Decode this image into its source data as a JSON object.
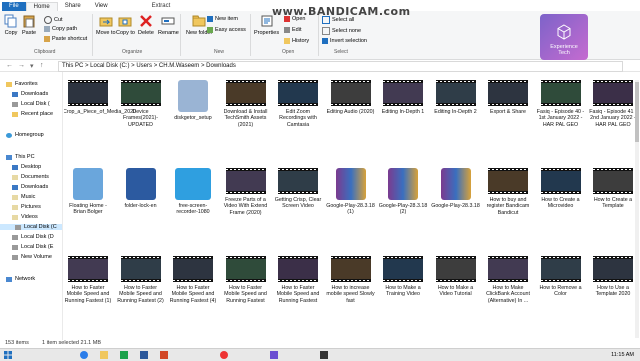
{
  "recorder": {
    "watermark": "www.BANDICAM.com"
  },
  "logo": {
    "line1": "Experience",
    "line2": "Tech"
  },
  "tabs": [
    "File",
    "Home",
    "Share",
    "View",
    "Extract"
  ],
  "ribbon": {
    "copy": "Copy",
    "paste": "Paste",
    "cut": "Cut",
    "copy_path": "Copy path",
    "paste_shortcut": "Paste shortcut",
    "move_to": "Move to",
    "copy_to": "Copy to",
    "delete": "Delete",
    "rename": "Rename",
    "new_folder": "New folder",
    "new_item": "New item",
    "easy_access": "Easy access",
    "properties": "Properties",
    "open": "Open",
    "edit": "Edit",
    "history": "History",
    "select_all": "Select all",
    "select_none": "Select none",
    "invert_selection": "Invert selection",
    "grp_clipboard": "Clipboard",
    "grp_organize": "Organize",
    "grp_new": "New",
    "grp_open": "Open",
    "grp_select": "Select"
  },
  "address": {
    "path": "This PC  >  Local Disk (C:)  >  Users  >  CH.M.Waseem  >  Downloads"
  },
  "nav": {
    "quick_access": "Favorites",
    "items": [
      "Downloads",
      "Local Disk (",
      "Recent place"
    ],
    "homegroup": "Homegroup",
    "this_pc": "This PC",
    "pc_items": [
      "Desktop",
      "Documents",
      "Downloads",
      "Music",
      "Pictures",
      "Videos",
      "Local Disk (C",
      "Local Disk (D",
      "Local Disk (E",
      "New Volume"
    ],
    "network": "Network"
  },
  "files": [
    {
      "name": "Crop_a_Piece_of_Media_2020",
      "kind": "video"
    },
    {
      "name": "Device Frames(2021)-UPDATED",
      "kind": "video"
    },
    {
      "name": "diskgetor_setup",
      "kind": "setup"
    },
    {
      "name": "Download & Install TechSmith Assets (2021)",
      "kind": "video"
    },
    {
      "name": "Edit Zoom Recordings with Camtasia",
      "kind": "video"
    },
    {
      "name": "Editing Audio (2020)",
      "kind": "video"
    },
    {
      "name": "Editing In-Depth 1",
      "kind": "video"
    },
    {
      "name": "Editing In-Depth 2",
      "kind": "video"
    },
    {
      "name": "Export & Share",
      "kind": "video"
    },
    {
      "name": "Fasiq - Episode 40 - 1st January 2022 - HAR PAL GEO",
      "kind": "video"
    },
    {
      "name": "Fasiq - Episode 41 - 2nd January 2022 - HAR PAL GEO",
      "kind": "video"
    },
    {
      "name": "Floating Home - Brian Bolger",
      "kind": "mp3"
    },
    {
      "name": "folder-lock-en",
      "kind": "lock"
    },
    {
      "name": "free-screen-recorder-1080",
      "kind": "recorder"
    },
    {
      "name": "Freeze Parts of a Video With Extend Frame (2020)",
      "kind": "video"
    },
    {
      "name": "Getting Crisp, Clear Screen Video",
      "kind": "video"
    },
    {
      "name": "Google-Play-28.3.18 (1)",
      "kind": "rar"
    },
    {
      "name": "Google-Play-28.3.18 (2)",
      "kind": "rar"
    },
    {
      "name": "Google-Play-28.3.18",
      "kind": "rar"
    },
    {
      "name": "How to buy and register Bandicam Bandicut",
      "kind": "video"
    },
    {
      "name": "How to Create a Microvideo",
      "kind": "video"
    },
    {
      "name": "How to Create a Template",
      "kind": "video"
    },
    {
      "name": "How to Faster Mobile Speed and Running Fastest (1)",
      "kind": "video"
    },
    {
      "name": "How to Faster Mobile Speed and Running Fastest (2)",
      "kind": "video"
    },
    {
      "name": "How to Faster Mobile Speed and Running Fastest (4)",
      "kind": "video"
    },
    {
      "name": "How to Faster Mobile Speed and Running Fastest",
      "kind": "video"
    },
    {
      "name": "How to Faster Mobile Speed and Running Fastest",
      "kind": "video"
    },
    {
      "name": "How to increase mobile speed Slowly fast",
      "kind": "video"
    },
    {
      "name": "How to Make a Training Video",
      "kind": "video"
    },
    {
      "name": "How to Make a Video Tutorial",
      "kind": "video"
    },
    {
      "name": "How to Make ClickBank Account (Alternative) In ...",
      "kind": "video"
    },
    {
      "name": "How to Remove a Color",
      "kind": "video"
    },
    {
      "name": "How to Use a Template 2020",
      "kind": "video"
    }
  ],
  "status": {
    "count": "153 items",
    "selected": "1 item selected  21.1 MB"
  },
  "taskbar": {
    "time": "11:15 AM"
  }
}
